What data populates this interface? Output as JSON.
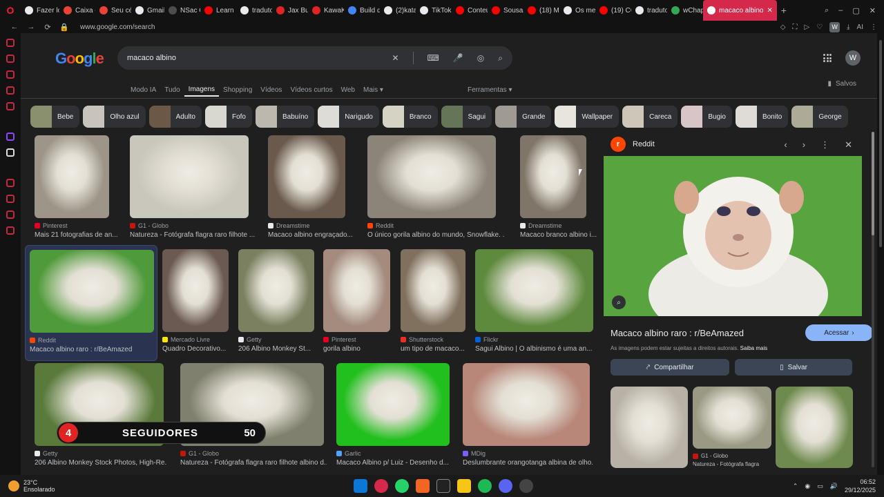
{
  "browser": {
    "tabs": [
      {
        "label": "Fazer lo",
        "color": "#e8eaed"
      },
      {
        "label": "Caixa d",
        "color": "#ea4335"
      },
      {
        "label": "Seu cé",
        "color": "#ea4335"
      },
      {
        "label": "Gmail",
        "color": "#e8eaed"
      },
      {
        "label": "NSac C",
        "color": "#4d4d4d"
      },
      {
        "label": "Learn E",
        "color": "#ff0000"
      },
      {
        "label": "traduto",
        "color": "#e8eaed"
      },
      {
        "label": "Jax Bui",
        "color": "#e02424"
      },
      {
        "label": "KawaK",
        "color": "#e02424"
      },
      {
        "label": "Build d",
        "color": "#4285f4"
      },
      {
        "label": "(2)kata",
        "color": "#e8eaed"
      },
      {
        "label": "TikTok",
        "color": "#e8eaed"
      },
      {
        "label": "Conteú",
        "color": "#ff0000"
      },
      {
        "label": "Sousaz",
        "color": "#ff0000"
      },
      {
        "label": "(18) ME",
        "color": "#ff0000"
      },
      {
        "label": "Os meli",
        "color": "#e8eaed"
      },
      {
        "label": "(19) CC",
        "color": "#ff0000"
      },
      {
        "label": "traduto",
        "color": "#e8eaed"
      },
      {
        "label": "wChap",
        "color": "#34a853"
      }
    ],
    "active_tab": "macaco albino",
    "active_tab_color": "#d5294b",
    "url": "www.google.com/search",
    "profile_letter": "W",
    "ai_label": "AI"
  },
  "google": {
    "logo": "Google",
    "query": "macaco albino",
    "avatar_letter": "W",
    "nav_tabs": [
      "Modo IA",
      "Tudo",
      "Imagens",
      "Shopping",
      "Vídeos",
      "Vídeos curtos",
      "Web",
      "Mais ▾"
    ],
    "tools": "Ferramentas ▾",
    "saved": "Salvos",
    "chips": [
      {
        "label": "Bebe",
        "color": "#8a8f6e"
      },
      {
        "label": "Olho azul",
        "color": "#c8c3bd"
      },
      {
        "label": "Adulto",
        "color": "#6b5846"
      },
      {
        "label": "Fofo",
        "color": "#d8d8d0"
      },
      {
        "label": "Babuíno",
        "color": "#bdb8ae"
      },
      {
        "label": "Narigudo",
        "color": "#dddcd6"
      },
      {
        "label": "Branco",
        "color": "#d5d3c4"
      },
      {
        "label": "Sagui",
        "color": "#657558"
      },
      {
        "label": "Grande",
        "color": "#a09a94"
      },
      {
        "label": "Wallpaper",
        "color": "#e7e5de"
      },
      {
        "label": "Careca",
        "color": "#cfc6ba"
      },
      {
        "label": "Bugio",
        "color": "#d8c5c8"
      },
      {
        "label": "Bonito",
        "color": "#dfdcd7"
      },
      {
        "label": "George",
        "color": "#aeaa98"
      }
    ],
    "results": [
      {
        "source": "Pinterest",
        "title": "Mais 21 fotografias de an...",
        "fav": "#e60023",
        "bg": "#9c9588"
      },
      {
        "source": "G1 - Globo",
        "title": "Natureza - Fotógrafa flagra raro filhote ...",
        "fav": "#c4170c",
        "bg": "#c9c6bc"
      },
      {
        "source": "Dreamstime",
        "title": "Macaco albino engraçado...",
        "fav": "#e8eaed",
        "bg": "#6a5a4d"
      },
      {
        "source": "Reddit",
        "title": "O único gorila albino do mundo, Snowflake. ...",
        "fav": "#ff4500",
        "bg": "#8b8478"
      },
      {
        "source": "Dreamstime",
        "title": "Macaco branco albino i...",
        "fav": "#e8eaed",
        "bg": "#7f7568"
      },
      {
        "source": "Reddit",
        "title": "Macaco albino raro : r/BeAmazed",
        "fav": "#ff4500",
        "bg": "#4f9a3a"
      },
      {
        "source": "Mercado Livre",
        "title": "Quadro Decorativo...",
        "fav": "#ffe600",
        "bg": "#6b5a52"
      },
      {
        "source": "Getty",
        "title": "206 Albino Monkey St...",
        "fav": "#e8eaed",
        "bg": "#7a8060"
      },
      {
        "source": "Pinterest",
        "title": "gorila albino",
        "fav": "#e60023",
        "bg": "#a48b7e"
      },
      {
        "source": "Shutterstock",
        "title": "um tipo de macaco...",
        "fav": "#ee2e24",
        "bg": "#80705e"
      },
      {
        "source": "Flickr",
        "title": "Sagui Albino | O albinismo é uma an...",
        "fav": "#0063dc",
        "bg": "#5e8a3e"
      },
      {
        "source": "Getty",
        "title": "206 Albino Monkey Stock Photos, High-Re...",
        "fav": "#e8eaed",
        "bg": "#5a7a3c"
      },
      {
        "source": "G1 - Globo",
        "title": "Natureza - Fotógrafa flagra raro filhote albino d...",
        "fav": "#c4170c",
        "bg": "#7f806d"
      },
      {
        "source": "Garlic",
        "title": "Macaco Albino p/ Luiz - Desenho d...",
        "fav": "#4da3ff",
        "bg": "#22c01e"
      },
      {
        "source": "MDig",
        "title": "Deslumbrante orangotanga albina de olho...",
        "fav": "#7b5cff",
        "bg": "#b8877a"
      }
    ],
    "panel": {
      "source": "Reddit",
      "title": "Macaco albino raro : r/BeAmazed",
      "visit": "Acessar",
      "copyright": "As imagens podem estar sujeitas a direitos autorais.",
      "learn_more": "Saiba mais",
      "share": "Compartilhar",
      "save": "Salvar",
      "related": [
        {
          "bg": "#b8b2a6"
        },
        {
          "bg": "#9a9a84",
          "source": "G1 - Globo",
          "title": "Natureza - Fotógrafa flagra"
        },
        {
          "bg": "#6f8a4e"
        }
      ]
    }
  },
  "overlay": {
    "number": "4",
    "label": "SEGUIDORES",
    "count": "50"
  },
  "taskbar": {
    "temp": "23°C",
    "weather": "Ensolarado",
    "time": "06:52",
    "date": "29/12/2025"
  }
}
